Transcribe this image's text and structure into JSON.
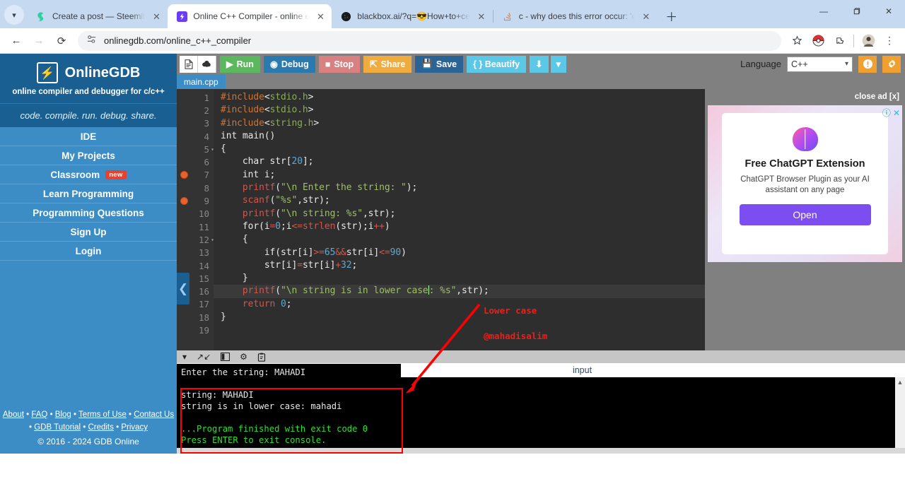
{
  "browser": {
    "tabs": [
      {
        "title": "Create a post — Steemit",
        "favicon": "steemit-icon",
        "active": false
      },
      {
        "title": "Online C++ Compiler - online e",
        "favicon": "onlinegdb-icon",
        "active": true
      },
      {
        "title": "blackbox.ai/?q=😎How+to+ce",
        "favicon": "blackbox-icon",
        "active": false
      },
      {
        "title": "c - why does this error occur: 'c",
        "favicon": "stackoverflow-icon",
        "active": false
      }
    ],
    "tab_list_icon": "chevron-down-icon",
    "new_tab_icon": "plus-icon",
    "window_controls": {
      "minimize": "—",
      "maximize": "❐",
      "close": "✕"
    },
    "nav": {
      "back": "←",
      "forward": "→",
      "reload": "⟳"
    },
    "omnibox": {
      "url": "onlinegdb.com/online_c++_compiler",
      "site_icon": "site-settings-icon"
    },
    "toolbar_icons": [
      "bookmark-star-icon",
      "pokeball-extension-icon",
      "extensions-puzzle-icon",
      "profile-avatar-icon",
      "chrome-menu-icon"
    ]
  },
  "sidebar": {
    "brand_logo": "lightning-bolt-icon",
    "brand_name": "OnlineGDB",
    "brand_sub": "online compiler and debugger for c/c++",
    "tagline": "code. compile. run. debug. share.",
    "items": [
      {
        "label": "IDE",
        "badge": ""
      },
      {
        "label": "My Projects",
        "badge": ""
      },
      {
        "label": "Classroom",
        "badge": "new"
      },
      {
        "label": "Learn Programming",
        "badge": ""
      },
      {
        "label": "Programming Questions",
        "badge": ""
      },
      {
        "label": "Sign Up",
        "badge": ""
      },
      {
        "label": "Login",
        "badge": ""
      }
    ],
    "collapse_icon": "chevron-left-icon",
    "footer_row1": [
      "About",
      "FAQ",
      "Blog",
      "Terms of Use",
      "Contact Us"
    ],
    "footer_row2": [
      "GDB Tutorial",
      "Credits",
      "Privacy"
    ],
    "copyright": "© 2016 - 2024 GDB Online"
  },
  "ide_toolbar": {
    "new_file_icon": "new-file-icon",
    "upload_icon": "upload-cloud-icon",
    "run": {
      "label": "Run",
      "icon": "play-icon"
    },
    "debug": {
      "label": "Debug",
      "icon": "debug-circle-icon"
    },
    "stop": {
      "label": "Stop",
      "icon": "stop-square-icon"
    },
    "share": {
      "label": "Share",
      "icon": "share-icon"
    },
    "save": {
      "label": "Save",
      "icon": "floppy-disk-icon"
    },
    "beautify": {
      "label": "{ } Beautify"
    },
    "download_icon": "download-icon",
    "download_caret": "caret-down-icon",
    "language_label": "Language",
    "language_value": "C++",
    "language_caret": "chevron-down-icon",
    "info_icon": "info-icon",
    "settings_icon": "gear-icon"
  },
  "file_tabs": [
    {
      "label": "main.cpp",
      "active": true
    }
  ],
  "editor": {
    "lines": [
      {
        "n": 1,
        "bp": false,
        "fold": false,
        "html": "<span class='k-inc'>#include</span><span class='k-pl'>&lt;</span><span class='k-hdr'>stdio.h</span><span class='k-pl'>&gt;</span>"
      },
      {
        "n": 2,
        "bp": false,
        "fold": false,
        "html": "<span class='k-inc'>#include</span><span class='k-pl'>&lt;</span><span class='k-hdr'>stdio.h</span><span class='k-pl'>&gt;</span>"
      },
      {
        "n": 3,
        "bp": false,
        "fold": false,
        "html": "<span class='k-inc'>#include</span><span class='k-pl'>&lt;</span><span class='k-hdr'>string.h</span><span class='k-pl'>&gt;</span>"
      },
      {
        "n": 4,
        "bp": false,
        "fold": false,
        "html": "<span class='k-type'>int main()</span>"
      },
      {
        "n": 5,
        "bp": false,
        "fold": true,
        "html": "<span class='k-pl'>{</span>"
      },
      {
        "n": 6,
        "bp": false,
        "fold": false,
        "html": "    <span class='k-type'>char str[</span><span class='k-num'>20</span><span class='k-type'>];</span>"
      },
      {
        "n": 7,
        "bp": true,
        "fold": false,
        "html": "    <span class='k-type'>int i;</span>"
      },
      {
        "n": 8,
        "bp": false,
        "fold": false,
        "html": "    <span class='k-fn'>printf</span><span class='k-pl'>(</span><span class='k-str'>\"\\n Enter the string: \"</span><span class='k-pl'>);</span>"
      },
      {
        "n": 9,
        "bp": true,
        "fold": false,
        "html": "    <span class='k-fn'>scanf</span><span class='k-pl'>(</span><span class='k-str'>\"%s\"</span><span class='k-pl'>,str);</span>"
      },
      {
        "n": 10,
        "bp": false,
        "fold": false,
        "html": "    <span class='k-fn'>printf</span><span class='k-pl'>(</span><span class='k-str'>\"\\n string: %s\"</span><span class='k-pl'>,str);</span>"
      },
      {
        "n": 11,
        "bp": false,
        "fold": false,
        "html": "    <span class='k-type'>for(i</span><span class='k-op'>=</span><span class='k-num'>0</span><span class='k-type'>;i</span><span class='k-op'>&lt;=</span><span class='k-fn'>strlen</span><span class='k-type'>(str);i</span><span class='k-op'>++</span><span class='k-type'>)</span>"
      },
      {
        "n": 12,
        "bp": false,
        "fold": true,
        "html": "    <span class='k-pl'>{</span>"
      },
      {
        "n": 13,
        "bp": false,
        "fold": false,
        "html": "        <span class='k-type'>if(str[i]</span><span class='k-op'>&gt;=</span><span class='k-num'>65</span><span class='k-op'>&amp;&amp;</span><span class='k-type'>str[i]</span><span class='k-op'>&lt;=</span><span class='k-num'>90</span><span class='k-type'>)</span>"
      },
      {
        "n": 14,
        "bp": false,
        "fold": false,
        "html": "        <span class='k-type'>str[i]</span><span class='k-op'>=</span><span class='k-type'>str[i]</span><span class='k-op'>+</span><span class='k-num'>32</span><span class='k-type'>;</span>"
      },
      {
        "n": 15,
        "bp": false,
        "fold": false,
        "html": "    <span class='k-pl'>}</span>"
      },
      {
        "n": 16,
        "bp": false,
        "fold": false,
        "hl": true,
        "html": "    <span class='k-fn'>printf</span><span class='k-pl'>(</span><span class='k-str'>\"\\n string is in lower case</span><span class='cursor-bar'></span><span class='k-str'>: %s\"</span><span class='k-pl'>,str);</span>"
      },
      {
        "n": 17,
        "bp": false,
        "fold": false,
        "html": "    <span class='k-fn'>return</span> <span class='k-num'>0</span><span class='k-pl'>;</span>"
      },
      {
        "n": 18,
        "bp": false,
        "fold": false,
        "html": "<span class='k-pl'>}</span>"
      },
      {
        "n": 19,
        "bp": false,
        "fold": false,
        "html": ""
      }
    ],
    "source_text": "#include<stdio.h>\n#include<stdio.h>\n#include<string.h>\nint main()\n{\n    char str[20];\n    int i;\n    printf(\"\\n Enter the string: \");\n    scanf(\"%s\",str);\n    printf(\"\\n string: %s\",str);\n    for(i=0;i<=strlen(str);i++)\n    {\n        if(str[i]>=65&&str[i]<=90)\n        str[i]=str[i]+32;\n    }\n    printf(\"\\n string is in lower case: %s\",str);\n    return 0;\n}",
    "annotations": [
      {
        "text": "Lower case",
        "color": "#e8201a"
      },
      {
        "text": "@mahadisalim",
        "color": "#e8201a"
      }
    ]
  },
  "ad": {
    "close_ad_label": "close ad [x]",
    "info_icon": "ad-info-icon",
    "close_icon": "ad-close-icon",
    "logo_icon": "brain-icon",
    "title": "Free ChatGPT Extension",
    "description": "ChatGPT Browser Plugin as your AI assistant on any page",
    "button_label": "Open"
  },
  "console": {
    "toolbar_icons": [
      "chevron-down-icon",
      "expand-arrows-icon",
      "layout-panel-icon",
      "gear-icon",
      "paste-clipboard-icon"
    ],
    "output_lines": [
      {
        "text": "Enter the string: MAHADI",
        "color": "white"
      },
      {
        "text": "",
        "color": "white"
      },
      {
        "text": "string: MAHADI",
        "color": "white"
      },
      {
        "text": "string is in lower case: mahadi",
        "color": "white"
      },
      {
        "text": "",
        "color": "white"
      },
      {
        "text": "...Program finished with exit code 0",
        "color": "green"
      },
      {
        "text": "Press ENTER to exit console.",
        "color": "green"
      }
    ],
    "input_label": "input",
    "input_value": ""
  },
  "colors": {
    "brand_blue": "#3c8dc5",
    "brand_dark": "#1a5f92",
    "run_green": "#5cb85c",
    "annotation_red": "#e8201a",
    "console_green": "#2ee02e",
    "ad_purple": "#7c4df0"
  }
}
